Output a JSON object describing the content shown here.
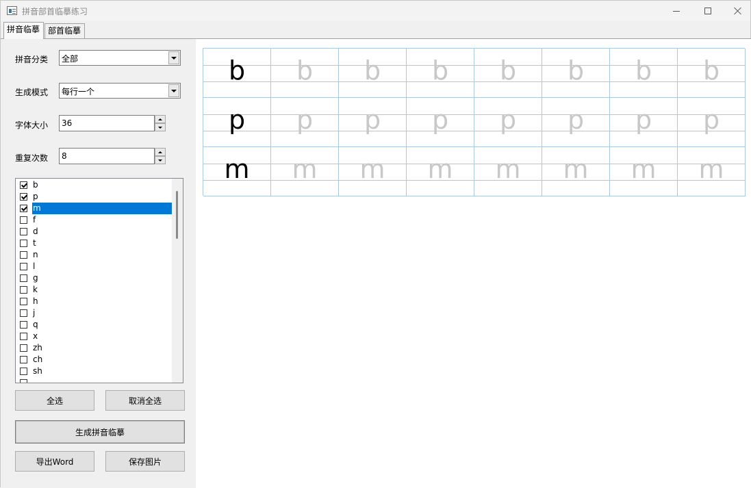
{
  "window": {
    "title": "拼音部首临摹练习"
  },
  "tabs": [
    {
      "label": "拼音临摹",
      "active": true
    },
    {
      "label": "部首临摹",
      "active": false
    }
  ],
  "form": {
    "category_label": "拼音分类",
    "category_value": "全部",
    "mode_label": "生成模式",
    "mode_value": "每行一个",
    "fontsize_label": "字体大小",
    "fontsize_value": "36",
    "repeat_label": "重复次数",
    "repeat_value": "8"
  },
  "pinyin_list": [
    {
      "label": "b",
      "checked": true,
      "selected": false
    },
    {
      "label": "p",
      "checked": true,
      "selected": false
    },
    {
      "label": "m",
      "checked": true,
      "selected": true
    },
    {
      "label": "f",
      "checked": false,
      "selected": false
    },
    {
      "label": "d",
      "checked": false,
      "selected": false
    },
    {
      "label": "t",
      "checked": false,
      "selected": false
    },
    {
      "label": "n",
      "checked": false,
      "selected": false
    },
    {
      "label": "l",
      "checked": false,
      "selected": false
    },
    {
      "label": "g",
      "checked": false,
      "selected": false
    },
    {
      "label": "k",
      "checked": false,
      "selected": false
    },
    {
      "label": "h",
      "checked": false,
      "selected": false
    },
    {
      "label": "j",
      "checked": false,
      "selected": false
    },
    {
      "label": "q",
      "checked": false,
      "selected": false
    },
    {
      "label": "x",
      "checked": false,
      "selected": false
    },
    {
      "label": "zh",
      "checked": false,
      "selected": false
    },
    {
      "label": "ch",
      "checked": false,
      "selected": false
    },
    {
      "label": "sh",
      "checked": false,
      "selected": false
    },
    {
      "label": "",
      "checked": false,
      "selected": false
    }
  ],
  "buttons": {
    "select_all": "全选",
    "deselect_all": "取消全选",
    "generate": "生成拼音临摹",
    "export_word": "导出Word",
    "save_image": "保存图片"
  },
  "practice_sheet": {
    "rows": [
      {
        "letter": "b",
        "repeat": 8
      },
      {
        "letter": "p",
        "repeat": 8
      },
      {
        "letter": "m",
        "repeat": 8
      }
    ],
    "model_color": "#000000",
    "trace_color": "#c8c8c8",
    "grid_color": "#a8c8e8"
  }
}
